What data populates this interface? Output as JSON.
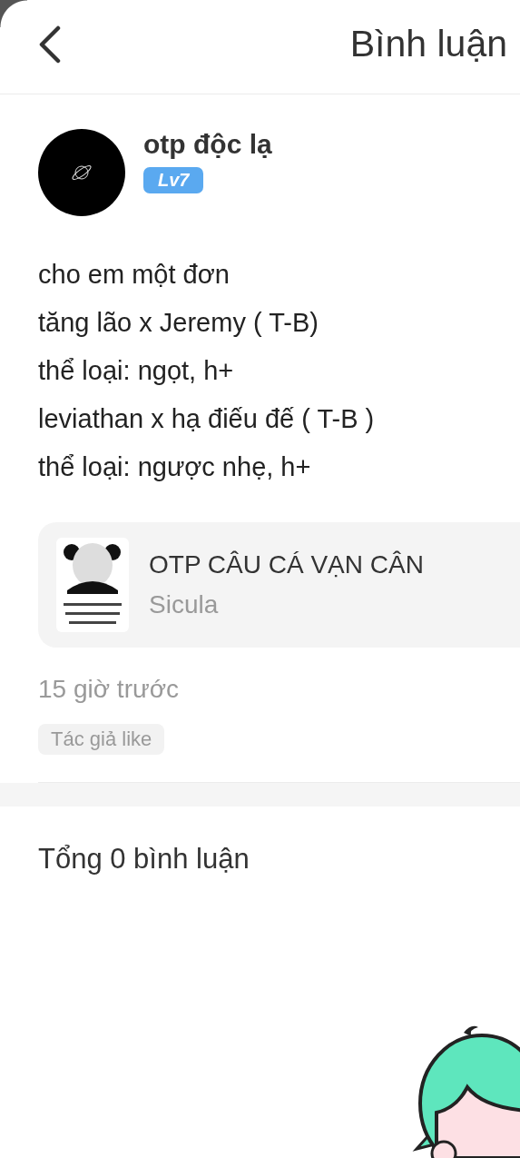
{
  "header": {
    "title": "Bình luận"
  },
  "post": {
    "author": {
      "name": "otp độc lạ",
      "level": "Lv7"
    },
    "lines": [
      "cho em một đơn",
      "tăng lão x Jeremy ( T-B)",
      "thể loại: ngọt, h+",
      "leviathan x hạ điếu đế ( T-B )",
      "thể loại: ngược nhẹ, h+"
    ],
    "work": {
      "title": "OTP CÂU CÁ VẠN CÂN",
      "author": "Sicula"
    },
    "time": "15 giờ trước",
    "tags": [
      "Tác giả like"
    ]
  },
  "comments": {
    "total": "Tổng 0 bình luận"
  }
}
